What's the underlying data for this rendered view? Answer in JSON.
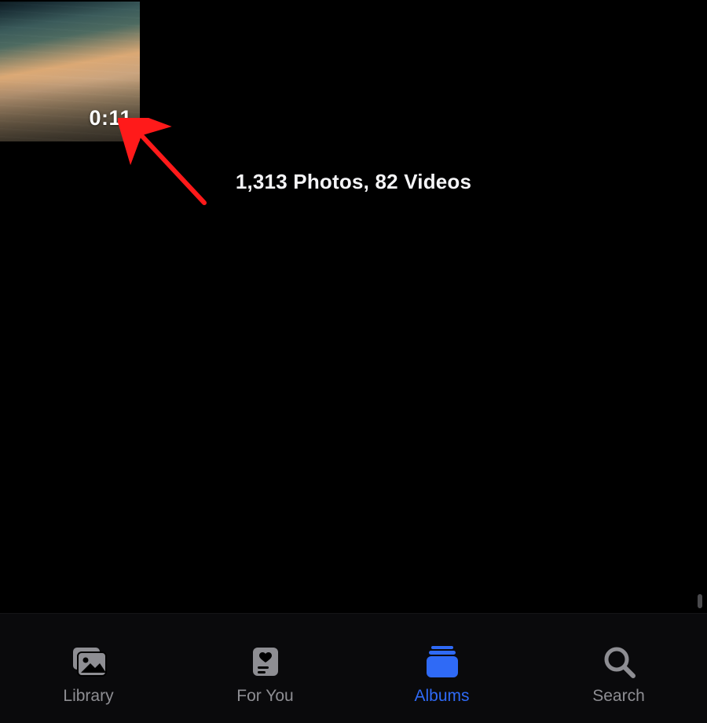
{
  "thumbnail": {
    "duration": "0:11"
  },
  "summary": {
    "text": "1,313 Photos, 82 Videos"
  },
  "tabs": {
    "library": {
      "label": "Library",
      "active": false
    },
    "foryou": {
      "label": "For You",
      "active": false
    },
    "albums": {
      "label": "Albums",
      "active": true
    },
    "search": {
      "label": "Search",
      "active": false
    }
  },
  "colors": {
    "accent": "#2f6af6",
    "inactive": "#8e8e93"
  }
}
